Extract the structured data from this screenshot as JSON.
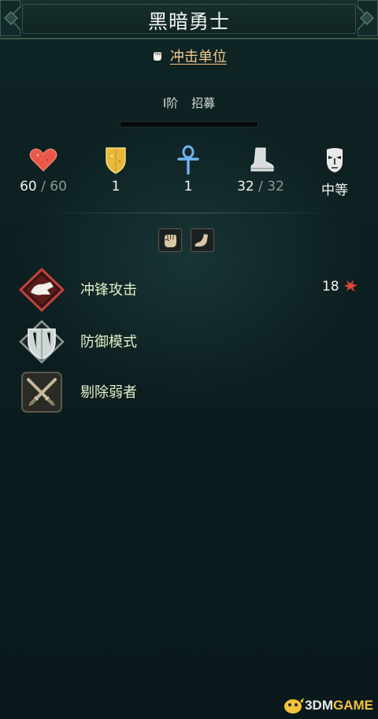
{
  "unit": {
    "name": "黑暗勇士",
    "type_label": "冲击单位",
    "tier": "I阶",
    "recruit_label": "招募",
    "xp_progress": 0
  },
  "stats": {
    "health": {
      "icon": "heart-icon",
      "current": "60",
      "separator": "/",
      "max": "60"
    },
    "defense": {
      "icon": "shield-icon",
      "value": "1"
    },
    "resistance": {
      "icon": "ankh-icon",
      "value": "1"
    },
    "movement": {
      "icon": "boot-icon",
      "current": "32",
      "separator": "/",
      "max": "32"
    },
    "morale": {
      "icon": "mask-icon",
      "value": "中等"
    }
  },
  "traits": [
    {
      "icon": "fist-icon"
    },
    {
      "icon": "foot-icon"
    }
  ],
  "abilities": [
    {
      "name": "冲锋攻击",
      "icon": "charge-attack-icon",
      "cost": "18"
    },
    {
      "name": "防御模式",
      "icon": "defense-mode-icon"
    },
    {
      "name": "剔除弱者",
      "icon": "crossed-swords-icon"
    }
  ],
  "watermark": {
    "prefix": "3DM",
    "suffix": "GAME"
  },
  "colors": {
    "accent_gold": "#f2c98a",
    "ability_text": "#e3f2c9",
    "panel_bg": "#0b1a1c"
  }
}
